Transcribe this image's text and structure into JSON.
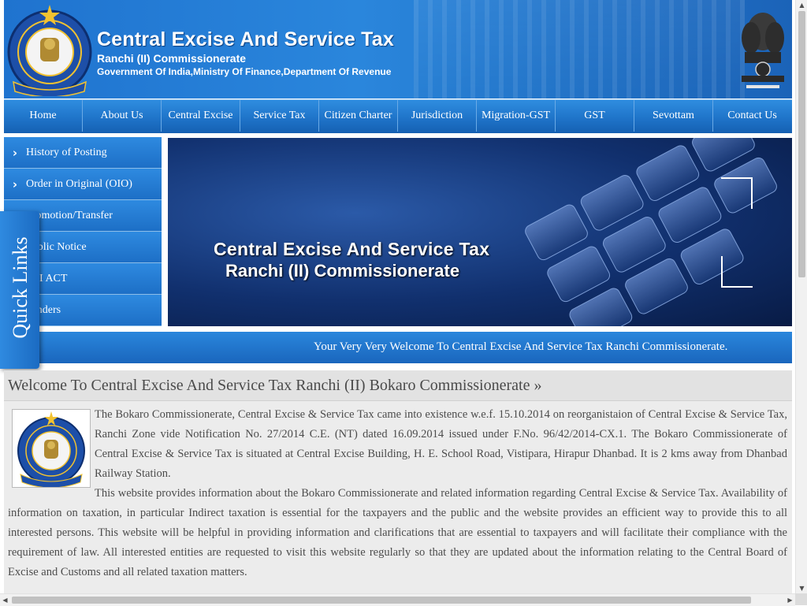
{
  "header": {
    "title": "Central Excise And Service Tax",
    "subtitle": "Ranchi (II) Commissionerate",
    "ministry": "Government Of India,Ministry Of Finance,Department Of Revenue"
  },
  "nav": {
    "items": [
      {
        "label": "Home"
      },
      {
        "label": "About Us"
      },
      {
        "label": "Central Excise"
      },
      {
        "label": "Service Tax"
      },
      {
        "label": "Citizen Charter"
      },
      {
        "label": "Jurisdiction"
      },
      {
        "label": "Migration-GST"
      },
      {
        "label": "GST"
      },
      {
        "label": "Sevottam"
      },
      {
        "label": "Contact Us"
      }
    ]
  },
  "sidebar": {
    "items": [
      {
        "label": "History of Posting"
      },
      {
        "label": "Order in Original (OIO)"
      },
      {
        "label": "Promotion/Transfer"
      },
      {
        "label": "Public Notice"
      },
      {
        "label": "RTI ACT"
      },
      {
        "label": "Tenders"
      }
    ]
  },
  "quick_links": {
    "label": "Quick Links"
  },
  "banner": {
    "line1": "Central Excise And Service Tax",
    "line2": "Ranchi (II) Commissionerate"
  },
  "marquee": {
    "text": "Your Very Very Welcome To Central Excise And Service Tax Ranchi Commissionerate."
  },
  "welcome": {
    "heading": "Welcome To Central Excise And Service Tax Ranchi (II) Bokaro Commissionerate »",
    "para1": "The Bokaro Commissionerate, Central Excise & Service Tax came into existence w.e.f. 15.10.2014 on reorganistaion of Central Excise & Service Tax, Ranchi Zone vide Notification No. 27/2014 C.E. (NT) dated 16.09.2014 issued under F.No. 96/42/2014-CX.1. The Bokaro Commissionerate of Central Excise & Service Tax is situated at Central Excise Building, H. E. School Road, Vistipara, Hirapur Dhanbad. It is 2 kms away from Dhanbad Railway Station.",
    "para2": "This website provides information about the Bokaro Commissionerate and related information regarding Central Excise & Service Tax. Availability of information on taxation, in particular Indirect taxation is essential for the taxpayers and the public and the website provides an efficient way to provide this to all interested persons. This website will be helpful in providing information and clarifications that are essential to taxpayers and will facilitate their compliance with the requirement of law. All interested entities are requested to visit this website regularly so that they are updated about the information relating to the Central Board of Excise and Customs and all related taxation matters."
  },
  "colors": {
    "primary_blue": "#1f74c9",
    "banner_dark": "#11306e",
    "content_bg": "#ececec"
  }
}
